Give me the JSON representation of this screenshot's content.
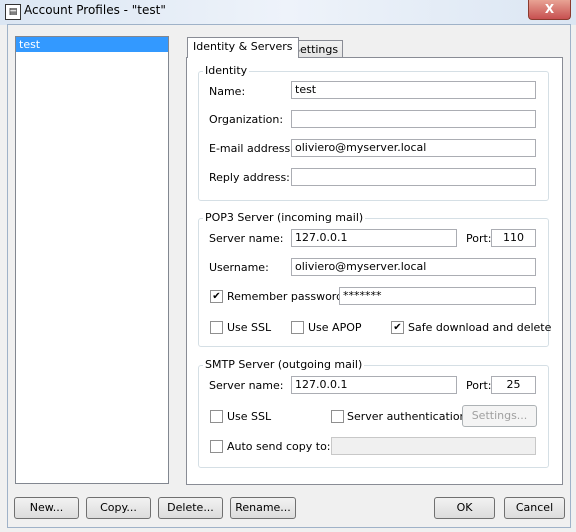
{
  "window": {
    "title": "Account Profiles - \"test\"",
    "close_label": "X"
  },
  "profiles": [
    "test"
  ],
  "tabs": [
    {
      "label": "Identity & Servers",
      "active": true
    },
    {
      "label": "Settings",
      "active": false
    }
  ],
  "identity": {
    "group_label": "Identity",
    "name_label": "Name:",
    "name": "test",
    "org_label": "Organization:",
    "org": "",
    "email_label": "E-mail address:",
    "email": "oliviero@myserver.local",
    "reply_label": "Reply address:",
    "reply": ""
  },
  "pop3": {
    "group_label": "POP3 Server (incoming mail)",
    "server_label": "Server name:",
    "server": "127.0.0.1",
    "port_label": "Port:",
    "port": "110",
    "username_label": "Username:",
    "username": "oliviero@myserver.local",
    "remember_label": "Remember password:",
    "remember": true,
    "password": "*******",
    "ssl_label": "Use SSL",
    "ssl": false,
    "apop_label": "Use APOP",
    "apop": false,
    "safe_label": "Safe download and delete",
    "safe": true
  },
  "smtp": {
    "group_label": "SMTP Server (outgoing mail)",
    "server_label": "Server name:",
    "server": "127.0.0.1",
    "port_label": "Port:",
    "port": "25",
    "ssl_label": "Use SSL",
    "ssl": false,
    "auth_label": "Server authentication:",
    "auth": false,
    "settings_label": "Settings...",
    "autosend_label": "Auto send copy to:",
    "autosend": false,
    "autosend_value": ""
  },
  "buttons": {
    "new": "New...",
    "copy": "Copy...",
    "delete": "Delete...",
    "rename": "Rename...",
    "ok": "OK",
    "cancel": "Cancel"
  },
  "check_mark": "✔"
}
